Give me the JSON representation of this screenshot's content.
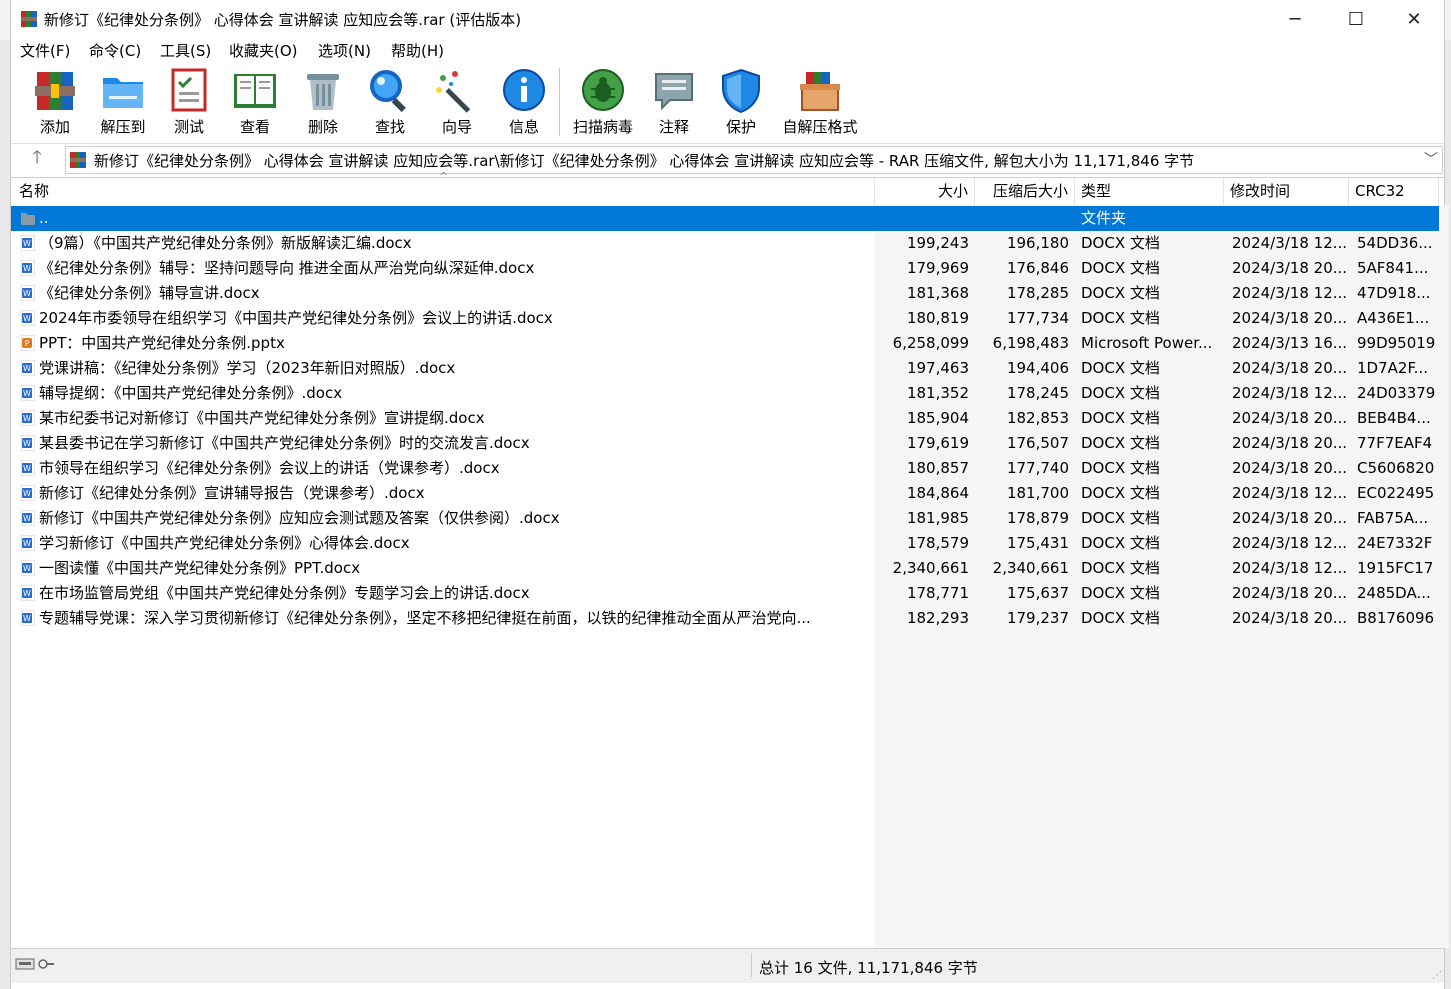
{
  "window": {
    "title": "新修订《纪律处分条例》 心得体会 宣讲解读 应知应会等.rar (评估版本)",
    "minimize": "─",
    "maximize": "☐",
    "close": "✕"
  },
  "menu": [
    "文件(F)",
    "命令(C)",
    "工具(S)",
    "收藏夹(O)",
    "选项(N)",
    "帮助(H)"
  ],
  "toolbar": [
    {
      "label": "添加",
      "icon": "add-archive-icon"
    },
    {
      "label": "解压到",
      "icon": "extract-folder-icon"
    },
    {
      "label": "测试",
      "icon": "test-checklist-icon"
    },
    {
      "label": "查看",
      "icon": "view-book-icon"
    },
    {
      "label": "删除",
      "icon": "trash-icon"
    },
    {
      "label": "查找",
      "icon": "magnifier-icon"
    },
    {
      "label": "向导",
      "icon": "wizard-wand-icon"
    },
    {
      "label": "信息",
      "icon": "info-icon"
    },
    {
      "label": "扫描病毒",
      "icon": "virus-scan-icon"
    },
    {
      "label": "注释",
      "icon": "comment-icon"
    },
    {
      "label": "保护",
      "icon": "shield-icon"
    },
    {
      "label": "自解压格式",
      "icon": "sfx-box-icon"
    }
  ],
  "address": {
    "up_glyph": "🡑",
    "path": "新修订《纪律处分条例》 心得体会 宣讲解读 应知应会等.rar\\新修订《纪律处分条例》 心得体会 宣讲解读 应知应会等 - RAR 压缩文件, 解包大小为 11,171,846 字节",
    "dropdown": "﹀"
  },
  "columns": {
    "name": "名称",
    "size": "大小",
    "packed": "压缩后大小",
    "type": "类型",
    "modified": "修改时间",
    "crc": "CRC32",
    "sort_glyph": "^"
  },
  "rows": [
    {
      "name": "..",
      "size": "",
      "packed": "",
      "type": "文件夹",
      "modified": "",
      "crc": "",
      "kind": "folder",
      "selected": true
    },
    {
      "name": "（9篇）《中国共产党纪律处分条例》新版解读汇编.docx",
      "size": "199,243",
      "packed": "196,180",
      "type": "DOCX 文档",
      "modified": "2024/3/18 12...",
      "crc": "54DD36...",
      "kind": "docx"
    },
    {
      "name": "《纪律处分条例》辅导：坚持问题导向 推进全面从严治党向纵深延伸.docx",
      "size": "179,969",
      "packed": "176,846",
      "type": "DOCX 文档",
      "modified": "2024/3/18 20...",
      "crc": "5AF841...",
      "kind": "docx"
    },
    {
      "name": "《纪律处分条例》辅导宣讲.docx",
      "size": "181,368",
      "packed": "178,285",
      "type": "DOCX 文档",
      "modified": "2024/3/18 12...",
      "crc": "47D918...",
      "kind": "docx"
    },
    {
      "name": "2024年市委领导在组织学习《中国共产党纪律处分条例》会议上的讲话.docx",
      "size": "180,819",
      "packed": "177,734",
      "type": "DOCX 文档",
      "modified": "2024/3/18 20...",
      "crc": "A436E1...",
      "kind": "docx"
    },
    {
      "name": "PPT：中国共产党纪律处分条例.pptx",
      "size": "6,258,099",
      "packed": "6,198,483",
      "type": "Microsoft Power...",
      "modified": "2024/3/13 16...",
      "crc": "99D95019",
      "kind": "pptx"
    },
    {
      "name": "党课讲稿：《纪律处分条例》学习（2023年新旧对照版）.docx",
      "size": "197,463",
      "packed": "194,406",
      "type": "DOCX 文档",
      "modified": "2024/3/18 20...",
      "crc": "1D7A2F...",
      "kind": "docx"
    },
    {
      "name": "辅导提纲：《中国共产党纪律处分条例》.docx",
      "size": "181,352",
      "packed": "178,245",
      "type": "DOCX 文档",
      "modified": "2024/3/18 12...",
      "crc": "24D03379",
      "kind": "docx"
    },
    {
      "name": "某市纪委书记对新修订《中国共产党纪律处分条例》宣讲提纲.docx",
      "size": "185,904",
      "packed": "182,853",
      "type": "DOCX 文档",
      "modified": "2024/3/18 20...",
      "crc": "BEB4B4...",
      "kind": "docx"
    },
    {
      "name": "某县委书记在学习新修订《中国共产党纪律处分条例》时的交流发言.docx",
      "size": "179,619",
      "packed": "176,507",
      "type": "DOCX 文档",
      "modified": "2024/3/18 20...",
      "crc": "77F7EAF4",
      "kind": "docx"
    },
    {
      "name": "市领导在组织学习《纪律处分条例》会议上的讲话（党课参考）.docx",
      "size": "180,857",
      "packed": "177,740",
      "type": "DOCX 文档",
      "modified": "2024/3/18 20...",
      "crc": "C5606820",
      "kind": "docx"
    },
    {
      "name": "新修订《纪律处分条例》宣讲辅导报告（党课参考）.docx",
      "size": "184,864",
      "packed": "181,700",
      "type": "DOCX 文档",
      "modified": "2024/3/18 12...",
      "crc": "EC022495",
      "kind": "docx"
    },
    {
      "name": "新修订《中国共产党纪律处分条例》应知应会测试题及答案（仅供参阅）.docx",
      "size": "181,985",
      "packed": "178,879",
      "type": "DOCX 文档",
      "modified": "2024/3/18 20...",
      "crc": "FAB75A...",
      "kind": "docx"
    },
    {
      "name": "学习新修订《中国共产党纪律处分条例》心得体会.docx",
      "size": "178,579",
      "packed": "175,431",
      "type": "DOCX 文档",
      "modified": "2024/3/18 12...",
      "crc": "24E7332F",
      "kind": "docx"
    },
    {
      "name": "一图读懂《中国共产党纪律处分条例》PPT.docx",
      "size": "2,340,661",
      "packed": "2,340,661",
      "type": "DOCX 文档",
      "modified": "2024/3/18 12...",
      "crc": "1915FC17",
      "kind": "docx"
    },
    {
      "name": "在市场监管局党组《中国共产党纪律处分条例》专题学习会上的讲话.docx",
      "size": "178,771",
      "packed": "175,637",
      "type": "DOCX 文档",
      "modified": "2024/3/18 20...",
      "crc": "2485DA...",
      "kind": "docx"
    },
    {
      "name": "专题辅导党课：深入学习贯彻新修订《纪律处分条例》，坚定不移把纪律挺在前面，以铁的纪律推动全面从严治党向...",
      "size": "182,293",
      "packed": "179,237",
      "type": "DOCX 文档",
      "modified": "2024/3/18 20...",
      "crc": "B8176096",
      "kind": "docx"
    }
  ],
  "status": {
    "summary": "总计 16 文件, 11,171,846 字节"
  },
  "colors": {
    "selection": "#0078d7",
    "word_icon": "#2b6ccf",
    "ppt_icon": "#e07a1f",
    "folder": "#8a9aa6"
  }
}
